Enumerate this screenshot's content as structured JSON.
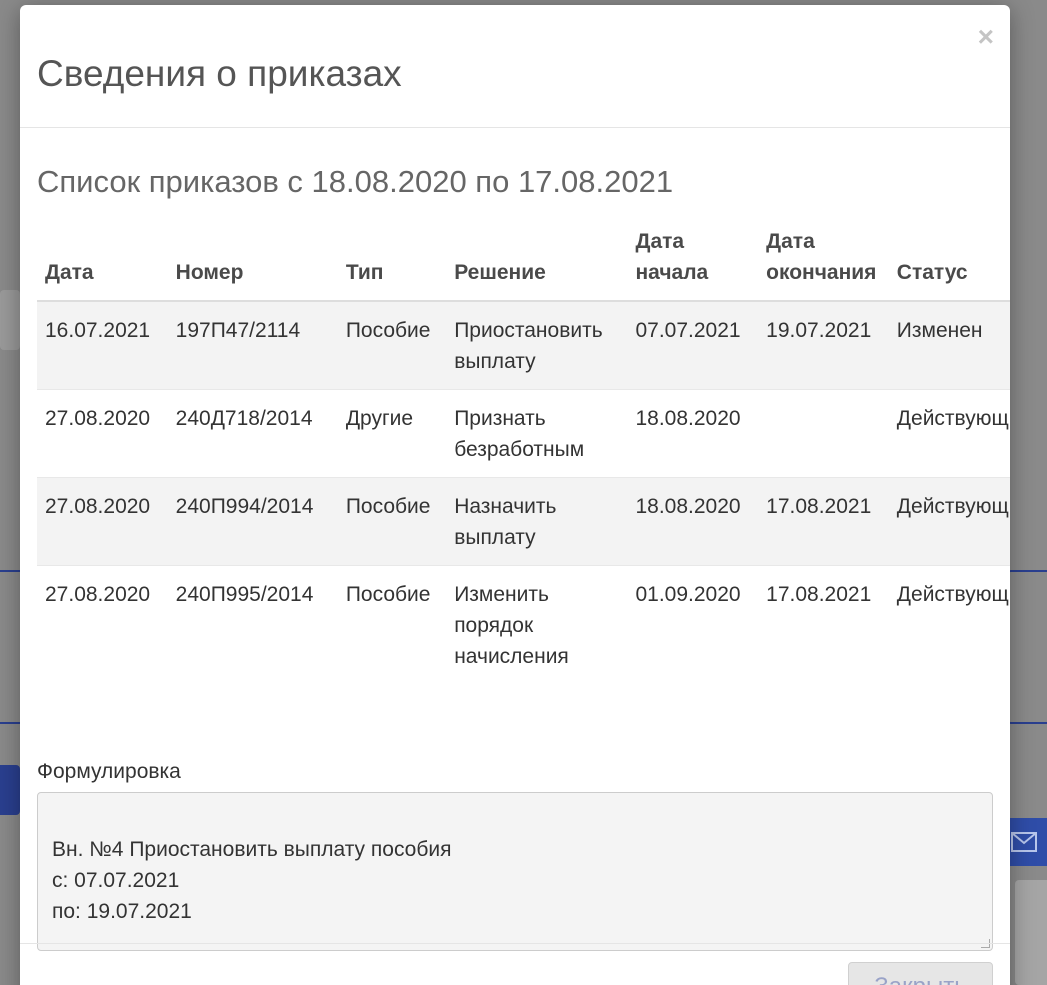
{
  "modal": {
    "title": "Сведения о приказах",
    "close_symbol": "×"
  },
  "list": {
    "title": "Список приказов с 18.08.2020 по 17.08.2021",
    "columns": [
      "Дата",
      "Номер",
      "Тип",
      "Решение",
      "Дата начала",
      "Дата окончания",
      "Статус"
    ],
    "rows": [
      {
        "date": "16.07.2021",
        "number": "197П47/2114",
        "type": "Пособие",
        "decision": "Приостановить выплату",
        "start": "07.07.2021",
        "end": "19.07.2021",
        "status": "Изменен"
      },
      {
        "date": "27.08.2020",
        "number": "240Д718/2014",
        "type": "Другие",
        "decision": "Признать безработным",
        "start": "18.08.2020",
        "end": "",
        "status": "Действующий"
      },
      {
        "date": "27.08.2020",
        "number": "240П994/2014",
        "type": "Пособие",
        "decision": "Назначить выплату",
        "start": "18.08.2020",
        "end": "17.08.2021",
        "status": "Действующий"
      },
      {
        "date": "27.08.2020",
        "number": "240П995/2014",
        "type": "Пособие",
        "decision": "Изменить порядок начисления",
        "start": "01.09.2020",
        "end": "17.08.2021",
        "status": "Действующий"
      }
    ]
  },
  "formulation": {
    "label": "Формулировка",
    "text": "Вн. №4 Приостановить выплату пособия\nс: 07.07.2021\nпо: 19.07.2021"
  },
  "footer": {
    "close_label": "Закрыть"
  },
  "icons": {
    "close": "close-icon",
    "mail": "mail-icon"
  },
  "colors": {
    "accent_blue": "#2f4da8",
    "overlay": "#7a7a7a"
  }
}
